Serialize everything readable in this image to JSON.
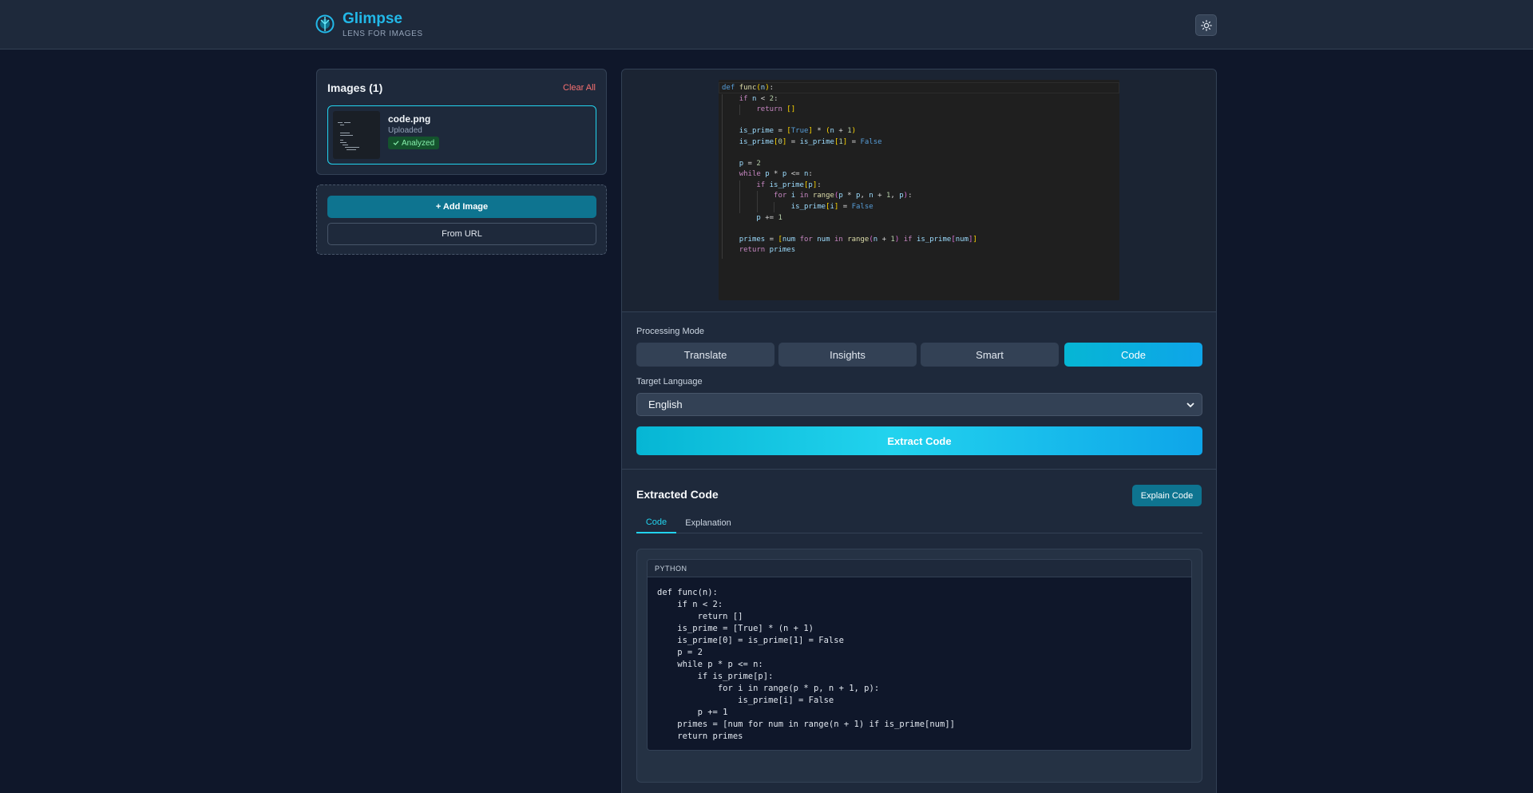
{
  "app": {
    "name": "Glimpse",
    "tagline": "LENS FOR IMAGES",
    "theme_icon": "sun-icon"
  },
  "images_panel": {
    "title": "Images (1)",
    "clear_all_label": "Clear All",
    "items": [
      {
        "file_name": "code.png",
        "status": "Uploaded",
        "badge": "Analyzed",
        "badge_icon": "check-icon"
      }
    ]
  },
  "add_panel": {
    "add_image_label": "+ Add Image",
    "from_url_label": "From URL"
  },
  "preview": {
    "code_lines": [
      "def func(n):",
      "    if n < 2:",
      "        return []",
      "",
      "    is_prime = [True] * (n + 1)",
      "    is_prime[0] = is_prime[1] = False",
      "",
      "    p = 2",
      "    while p * p <= n:",
      "        if is_prime[p]:",
      "            for i in range(p * p, n + 1, p):",
      "                is_prime[i] = False",
      "        p += 1",
      "",
      "    primes = [num for num in range(n + 1) if is_prime[num]]",
      "    return primes"
    ]
  },
  "processing": {
    "mode_label": "Processing Mode",
    "modes": [
      "Translate",
      "Insights",
      "Smart",
      "Code"
    ],
    "active_mode": "Code",
    "target_language_label": "Target Language",
    "target_language_value": "English",
    "extract_button_label": "Extract Code"
  },
  "result": {
    "title": "Extracted Code",
    "explain_button_label": "Explain Code",
    "tabs": [
      "Code",
      "Explanation"
    ],
    "active_tab": "Code",
    "language": "PYTHON",
    "code": "def func(n):\n    if n < 2:\n        return []\n    is_prime = [True] * (n + 1)\n    is_prime[0] = is_prime[1] = False\n    p = 2\n    while p * p <= n:\n        if is_prime[p]:\n            for i in range(p * p, n + 1, p):\n                is_prime[i] = False\n        p += 1\n    primes = [num for num in range(n + 1) if is_prime[num]]\n    return primes"
  },
  "colors": {
    "accent": "#22b8e8",
    "background": "#0f172a",
    "panel": "#1e293b",
    "danger": "#f87171",
    "success": "#86efac"
  }
}
